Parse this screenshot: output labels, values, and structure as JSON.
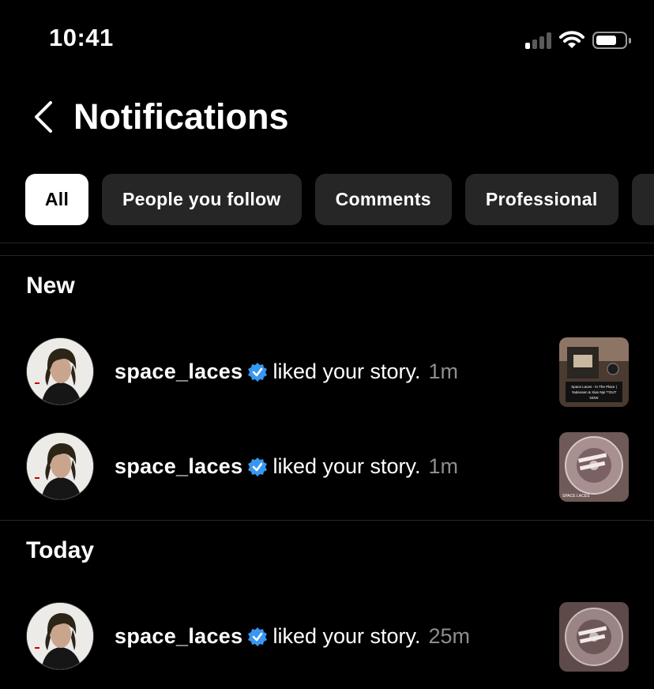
{
  "status_bar": {
    "time": "10:41",
    "icons": [
      "cellular-signal-icon",
      "wifi-icon",
      "battery-icon"
    ]
  },
  "header": {
    "title": "Notifications",
    "back_icon": "chevron-left-icon"
  },
  "tabs": [
    {
      "label": "All",
      "active": true
    },
    {
      "label": "People you follow",
      "active": false
    },
    {
      "label": "Comments",
      "active": false
    },
    {
      "label": "Professional",
      "active": false
    },
    {
      "label": "",
      "active": false
    }
  ],
  "sections": [
    {
      "title": "New",
      "items": [
        {
          "username": "space_laces",
          "verified": true,
          "action": "liked your story.",
          "time": "1m",
          "thumb_caption": "Space Laces - In The Place | Yadeosen & Xian Npi **OUT NOW"
        },
        {
          "username": "space_laces",
          "verified": true,
          "action": "liked your story.",
          "time": "1m",
          "thumb_caption": "SPACE LACES"
        }
      ]
    },
    {
      "title": "Today",
      "items": [
        {
          "username": "space_laces",
          "verified": true,
          "action": "liked your story.",
          "time": "25m",
          "thumb_caption": ""
        }
      ]
    }
  ],
  "colors": {
    "background": "#000000",
    "chip": "#262626",
    "active_chip": "#ffffff",
    "muted_text": "#8e8e8e",
    "verified_blue": "#3897f0"
  }
}
